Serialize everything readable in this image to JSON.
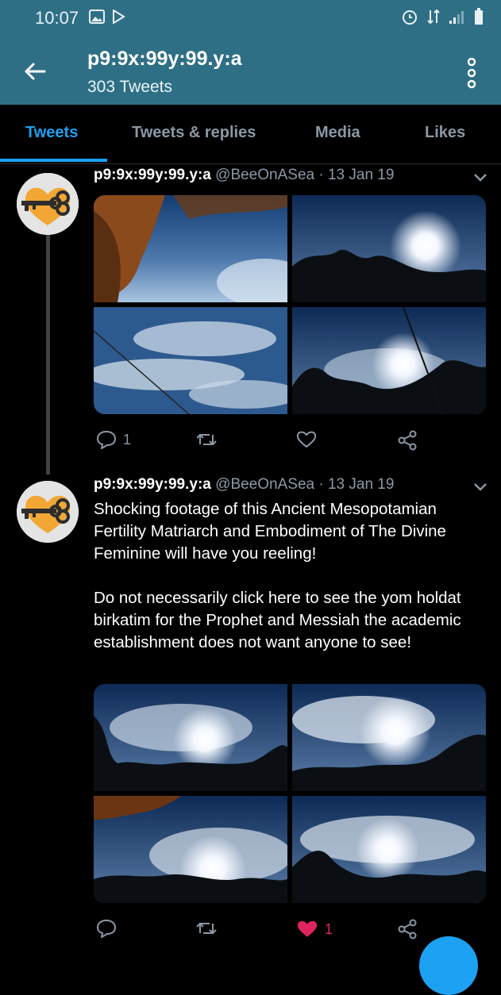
{
  "status_bar": {
    "time": "10:07"
  },
  "header": {
    "title": "p9:9x:99y:99.y:a",
    "subtitle": "303 Tweets"
  },
  "tabs": [
    "Tweets",
    "Tweets & replies",
    "Media",
    "Likes"
  ],
  "tweets": [
    {
      "name": "p9:9x:99y:99.y:a",
      "meta": "@BeeOnASea · 13 Jan 19",
      "text": "",
      "replies": "1",
      "retweets": "",
      "likes": ""
    },
    {
      "name": "p9:9x:99y:99.y:a",
      "meta": "@BeeOnASea · 13 Jan 19",
      "text": "Shocking footage of this Ancient Mesopotamian Fertility Matriarch and Embodiment of The Divine Feminine will have you reeling!\n\nDo not necessarily click here to see the yom holdat birkatim for the Prophet and Messiah the academic establishment does not want anyone to see!",
      "replies": "",
      "retweets": "",
      "likes": "1"
    }
  ],
  "colors": {
    "header": "#2f6f86",
    "accent": "#1da1f2",
    "like": "#e0245e",
    "muted": "#8b98a5"
  }
}
